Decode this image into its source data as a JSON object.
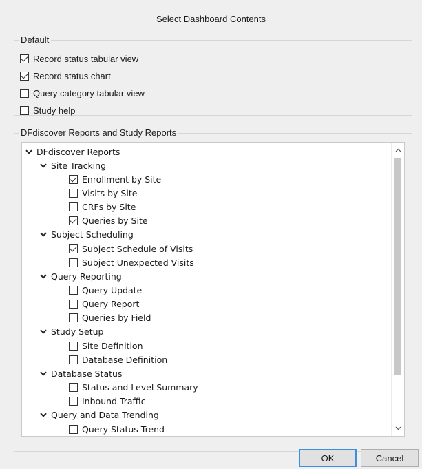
{
  "dialog": {
    "title": "Select Dashboard Contents"
  },
  "default_group": {
    "legend": "Default",
    "options": [
      {
        "label": "Record status tabular view",
        "checked": true
      },
      {
        "label": "Record status chart",
        "checked": true
      },
      {
        "label": "Query category tabular view",
        "checked": false
      },
      {
        "label": "Study help",
        "checked": false
      }
    ]
  },
  "reports_group": {
    "legend": "DFdiscover Reports and Study Reports",
    "tree": {
      "root": {
        "label": "DFdiscover Reports",
        "expanded": true
      },
      "categories": [
        {
          "label": "Site Tracking",
          "expanded": true,
          "items": [
            {
              "label": "Enrollment by Site",
              "checked": true
            },
            {
              "label": "Visits by Site",
              "checked": false
            },
            {
              "label": "CRFs by Site",
              "checked": false
            },
            {
              "label": "Queries by Site",
              "checked": true
            }
          ]
        },
        {
          "label": "Subject Scheduling",
          "expanded": true,
          "items": [
            {
              "label": "Subject Schedule of Visits",
              "checked": true
            },
            {
              "label": "Subject Unexpected Visits",
              "checked": false
            }
          ]
        },
        {
          "label": "Query Reporting",
          "expanded": true,
          "items": [
            {
              "label": "Query Update",
              "checked": false
            },
            {
              "label": "Query Report",
              "checked": false
            },
            {
              "label": "Queries by Field",
              "checked": false
            }
          ]
        },
        {
          "label": "Study Setup",
          "expanded": true,
          "items": [
            {
              "label": "Site Definition",
              "checked": false
            },
            {
              "label": "Database Definition",
              "checked": false
            }
          ]
        },
        {
          "label": "Database Status",
          "expanded": true,
          "items": [
            {
              "label": "Status and Level Summary",
              "checked": false
            },
            {
              "label": "Inbound Traffic",
              "checked": false
            }
          ]
        },
        {
          "label": "Query and Data Trending",
          "expanded": true,
          "items": [
            {
              "label": "Query Status Trend",
              "checked": false
            },
            {
              "label": "",
              "checked": false
            }
          ]
        }
      ]
    }
  },
  "buttons": {
    "ok": "OK",
    "cancel": "Cancel"
  },
  "icons": {
    "expand": "chevron-down-icon",
    "scroll_up": "scroll-up-arrow-icon",
    "scroll_down": "scroll-down-arrow-icon"
  }
}
